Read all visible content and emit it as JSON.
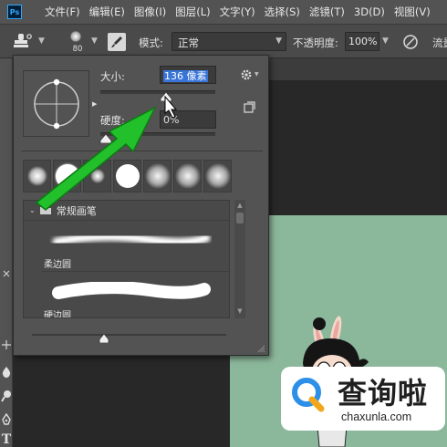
{
  "app": {
    "logo_text": "Ps"
  },
  "menu": [
    "文件(F)",
    "编辑(E)",
    "图像(I)",
    "图层(L)",
    "文字(Y)",
    "选择(S)",
    "滤镜(T)",
    "3D(D)",
    "视图(V)"
  ],
  "options_bar": {
    "brush_size_value": "80",
    "mode_label": "模式:",
    "mode_value": "正常",
    "opacity_label": "不透明度:",
    "opacity_value": "100%",
    "flow_label": "流量"
  },
  "brush_panel": {
    "size_label": "大小:",
    "size_value": "136 像素",
    "hardness_label": "硬度:",
    "hardness_value": "0%",
    "size_fraction": 0.55,
    "hardness_fraction": 0.0,
    "recent_brushes": [
      {
        "type": "soft",
        "size": "medium"
      },
      {
        "type": "hard",
        "size": "large"
      },
      {
        "type": "soft",
        "size": "small"
      },
      {
        "type": "hard",
        "size": "large"
      },
      {
        "type": "soft",
        "size": "large"
      },
      {
        "type": "soft",
        "size": "large"
      },
      {
        "type": "soft",
        "size": "large"
      }
    ],
    "group_name": "常规画笔",
    "presets": [
      {
        "name": "柔边圆",
        "stroke": "soft"
      },
      {
        "name": "硬边圆",
        "stroke": "hard"
      }
    ]
  },
  "watermark": {
    "title": "查询啦",
    "domain": "chaxunla.com"
  },
  "colors": {
    "accent_arrow": "#22c02b",
    "canvas": "#8bb79b",
    "watermark_brand": "#2c8fe8"
  }
}
